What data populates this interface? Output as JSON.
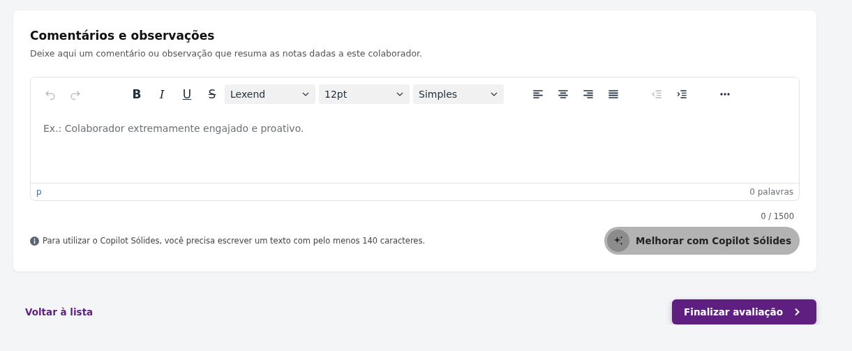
{
  "card": {
    "title": "Comentários e observações",
    "subtitle": "Deixe aqui um comentário ou observação que resuma as notas dadas a este colaborador."
  },
  "toolbar": [
    {
      "kind": "undo",
      "disabled": true
    },
    {
      "kind": "redo",
      "disabled": true
    },
    {
      "kind": "gap"
    },
    {
      "kind": "bold",
      "label": "B",
      "disabled": false
    },
    {
      "kind": "italic",
      "label": "I",
      "disabled": false
    },
    {
      "kind": "underline",
      "label": "U",
      "disabled": false
    },
    {
      "kind": "strike",
      "label": "S",
      "disabled": false
    },
    {
      "kind": "select",
      "value": "Lexend"
    },
    {
      "kind": "select",
      "value": "12pt"
    },
    {
      "kind": "select",
      "value": "Simples"
    },
    {
      "kind": "gap"
    },
    {
      "kind": "align-left",
      "disabled": false
    },
    {
      "kind": "align-center",
      "disabled": false
    },
    {
      "kind": "align-right",
      "disabled": false
    },
    {
      "kind": "justify",
      "disabled": false
    },
    {
      "kind": "gap"
    },
    {
      "kind": "outdent",
      "disabled": true
    },
    {
      "kind": "indent",
      "disabled": false
    },
    {
      "kind": "gap"
    },
    {
      "kind": "more",
      "disabled": false
    }
  ],
  "editor": {
    "placeholder": "Ex.: Colaborador extremamente engajado e proativo.",
    "path": "p",
    "word_count": "0 palavras"
  },
  "char_count": "0 / 1500",
  "info": "Para utilizar o Copilot Sólides, você precisa escrever um texto com pelo menos 140 caracteres.",
  "copilot_button": {
    "label": "Melhorar com Copilot Sólides",
    "disabled": true
  },
  "footer": {
    "back_link": "Voltar à lista",
    "finish_button": "Finalizar avaliação"
  }
}
